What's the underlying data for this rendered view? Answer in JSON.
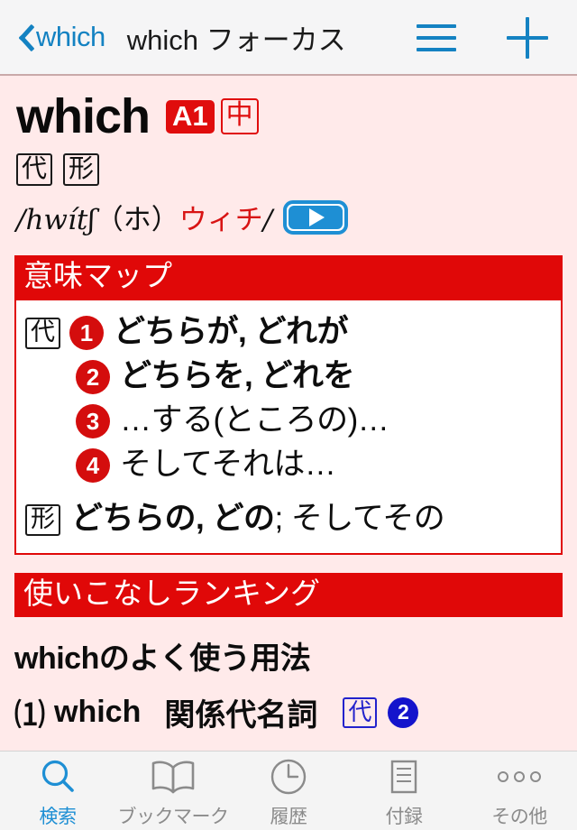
{
  "navbar": {
    "back_icon": "chevron-left-icon",
    "back_label": "which",
    "title": "which フォーカス",
    "menu_icon": "hamburger-menu-icon",
    "add_icon": "plus-icon"
  },
  "entry": {
    "headword": "which",
    "cefr_badge": "A1",
    "level_badge": "中",
    "pos_tags": [
      "代",
      "形"
    ],
    "pronunciation": {
      "open_slash": "/",
      "ipa": "hwítʃ",
      "kana_plain": "（ホ）",
      "kana_red": "ウィチ",
      "close_slash": "/"
    },
    "audio_button": "play-audio-icon"
  },
  "meaning_map": {
    "header": "意味マップ",
    "pronoun_tag": "代",
    "adjective_tag": "形",
    "senses": [
      {
        "num": "1",
        "text": "どちらが, どれが",
        "bold": true
      },
      {
        "num": "2",
        "text": "どちらを, どれを",
        "bold": true
      },
      {
        "num": "3",
        "text": "…する(ところの)…",
        "bold": false
      },
      {
        "num": "4",
        "text": "そしてそれは…",
        "bold": false
      }
    ],
    "adjective_bold": "どちらの, どの",
    "adjective_rest": "; そしてその"
  },
  "usage_ranking": {
    "header": "使いこなしランキング",
    "title": "whichのよく使う用法",
    "items": [
      {
        "num": "⑴",
        "word": "which",
        "desc": "関係代名詞",
        "tag_box": "代",
        "tag_circle": "2"
      }
    ]
  },
  "tabbar": {
    "tabs": [
      {
        "icon": "search-icon",
        "label": "検索",
        "active": true
      },
      {
        "icon": "bookmark-book-icon",
        "label": "ブックマーク",
        "active": false
      },
      {
        "icon": "history-clock-icon",
        "label": "履歴",
        "active": false
      },
      {
        "icon": "appendix-document-icon",
        "label": "付録",
        "active": false
      },
      {
        "icon": "more-dots-icon",
        "label": "その他",
        "active": false
      }
    ]
  },
  "colors": {
    "accent_blue": "#1e8fd4",
    "brand_red": "#e00808",
    "page_background": "#ffeaea"
  }
}
